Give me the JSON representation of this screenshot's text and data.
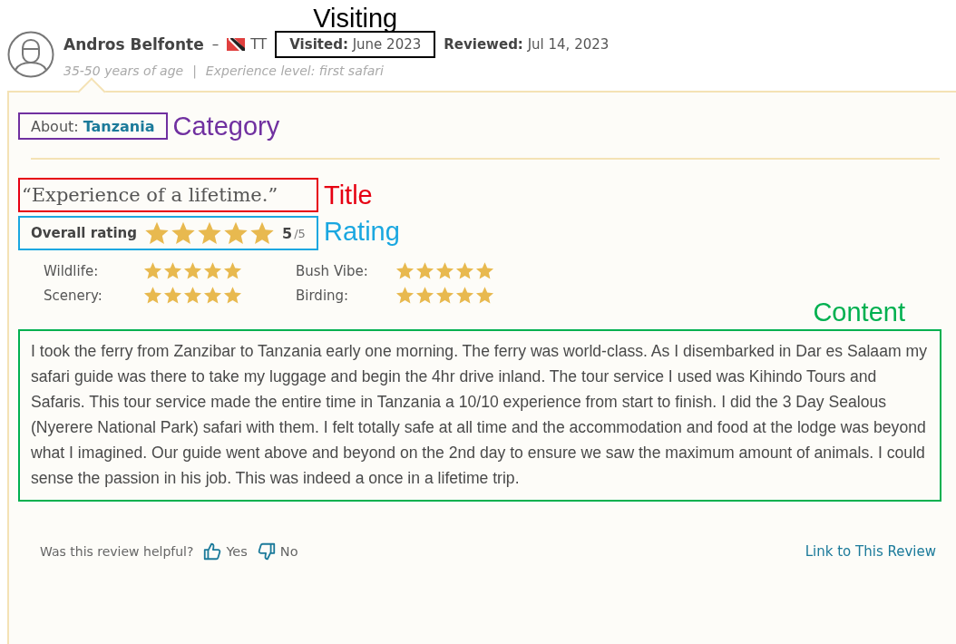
{
  "reviewer": {
    "name": "Andros Belfonte",
    "separator": "–",
    "country": "TT",
    "age": "35-50 years of age",
    "divider": "|",
    "experience": "Experience level: first safari"
  },
  "visited": {
    "label": "Visited:",
    "value": "June 2023",
    "annotation": {
      "label": "Visiting",
      "color": "#000000"
    }
  },
  "reviewed": {
    "label": "Reviewed:",
    "value": "Jul 14, 2023"
  },
  "about": {
    "label": "About:",
    "value": "Tanzania",
    "annotation": {
      "label": "Category",
      "color": "#7030a0"
    }
  },
  "title": {
    "text": "“Experience of a lifetime.”",
    "annotation": {
      "label": "Title",
      "color": "#e60012"
    }
  },
  "overall": {
    "label": "Overall rating",
    "stars": 5,
    "score": "5",
    "out_of": "/5",
    "annotation": {
      "label": "Rating",
      "color": "#1aa7e0"
    }
  },
  "subratings": [
    {
      "label": "Wildlife:",
      "stars": 5
    },
    {
      "label": "Bush Vibe:",
      "stars": 5
    },
    {
      "label": "Scenery:",
      "stars": 5
    },
    {
      "label": "Birding:",
      "stars": 5
    }
  ],
  "content": {
    "text": "I took the ferry from Zanzibar to Tanzania early one morning. The ferry was world-class. As I disembarked in Dar es Salaam my safari guide was there to take my luggage and begin the 4hr drive inland. The tour service I used was Kihindo Tours and Safaris. This tour service made the entire time in Tanzania a 10/10 experience from start to finish. I did the 3 Day Sealous (Nyerere National Park) safari with them. I felt totally safe at all time and the accommodation and food at the lodge was beyond what I imagined. Our guide went above and beyond on the 2nd day to ensure we saw the maximum amount of animals. I could sense the passion in his job. This was indeed a once in a lifetime trip.",
    "annotation": {
      "label": "Content",
      "color": "#00b050"
    }
  },
  "footer": {
    "question": "Was this review helpful?",
    "yes": "Yes",
    "no": "No",
    "link": "Link to This Review"
  }
}
